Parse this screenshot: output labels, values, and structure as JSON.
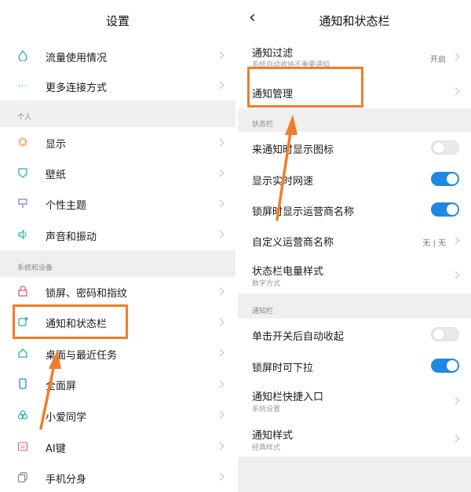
{
  "colors": {
    "accent": "#1e88e5",
    "highlight": "#f07d2a",
    "background": "#efefef"
  },
  "left": {
    "title": "设置",
    "group1": [
      {
        "label": "流量使用情况",
        "icon": "data-usage-icon"
      },
      {
        "label": "更多连接方式",
        "icon": "more-dots-icon"
      }
    ],
    "section_personal": "个人",
    "personal": [
      {
        "label": "显示",
        "icon": "sun-icon"
      },
      {
        "label": "壁纸",
        "icon": "wallpaper-icon"
      },
      {
        "label": "个性主题",
        "icon": "theme-brush-icon"
      },
      {
        "label": "声音和振动",
        "icon": "speaker-icon"
      }
    ],
    "section_system": "系统和设备",
    "system": [
      {
        "label": "锁屏、密码和指纹",
        "icon": "lock-icon"
      },
      {
        "label": "通知和状态栏",
        "icon": "notification-icon"
      },
      {
        "label": "桌面与最近任务",
        "icon": "home-icon"
      },
      {
        "label": "全面屏",
        "icon": "phone-icon"
      },
      {
        "label": "小爱同学",
        "icon": "xiaoai-icon"
      },
      {
        "label": "AI键",
        "icon": "ai-key-icon"
      },
      {
        "label": "手机分身",
        "icon": "second-space-icon"
      }
    ]
  },
  "right": {
    "title": "通知和状态栏",
    "filter": {
      "label": "通知过滤",
      "sub": "系统自动收纳不重要通知",
      "value": "开启"
    },
    "manage": {
      "label": "通知管理"
    },
    "section_statusbar": "状态栏",
    "statusbar": [
      {
        "label": "来通知时显示图标",
        "on": false
      },
      {
        "label": "显示实时网速",
        "on": true
      },
      {
        "label": "锁屏时显示运营商名称",
        "on": true
      }
    ],
    "carrier": {
      "label": "自定义运营商名称",
      "value": "无 | 无"
    },
    "battery": {
      "label": "状态栏电量样式",
      "sub": "数字方式"
    },
    "section_notifbar": "通知栏",
    "notifbar_toggles": [
      {
        "label": "单击开关后自动收起",
        "on": false
      },
      {
        "label": "锁屏时可下拉",
        "on": true
      }
    ],
    "shortcut": {
      "label": "通知栏快捷入口",
      "sub": "系统设置"
    },
    "style": {
      "label": "通知样式",
      "sub": "经典样式"
    }
  }
}
